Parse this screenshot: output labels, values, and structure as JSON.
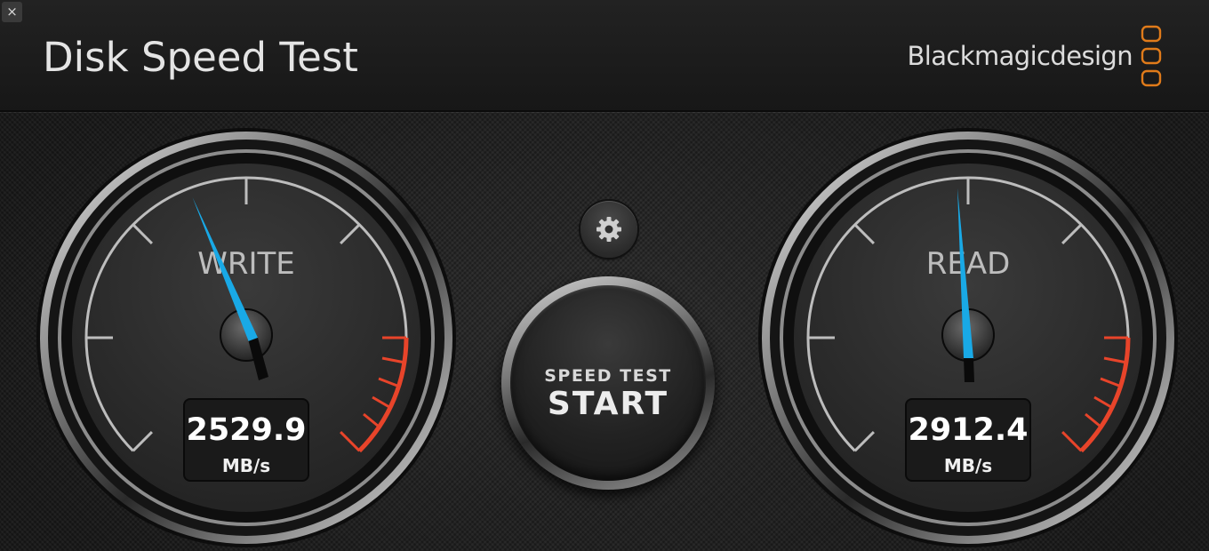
{
  "window": {
    "close_glyph": "×"
  },
  "header": {
    "title": "Disk Speed Test",
    "brand": "Blackmagicdesign",
    "brand_accent": "#e07b1a"
  },
  "write_gauge": {
    "label": "WRITE",
    "value": "2529.9",
    "unit": "MB/s",
    "needle_color": "#19a9e6"
  },
  "read_gauge": {
    "label": "READ",
    "value": "2912.4",
    "unit": "MB/s",
    "needle_color": "#19a9e6"
  },
  "settings": {
    "icon": "gear-icon"
  },
  "start_button": {
    "line1": "SPEED TEST",
    "line2": "START"
  },
  "colors": {
    "redzone": "#e8442a",
    "needle": "#19a9e6"
  }
}
